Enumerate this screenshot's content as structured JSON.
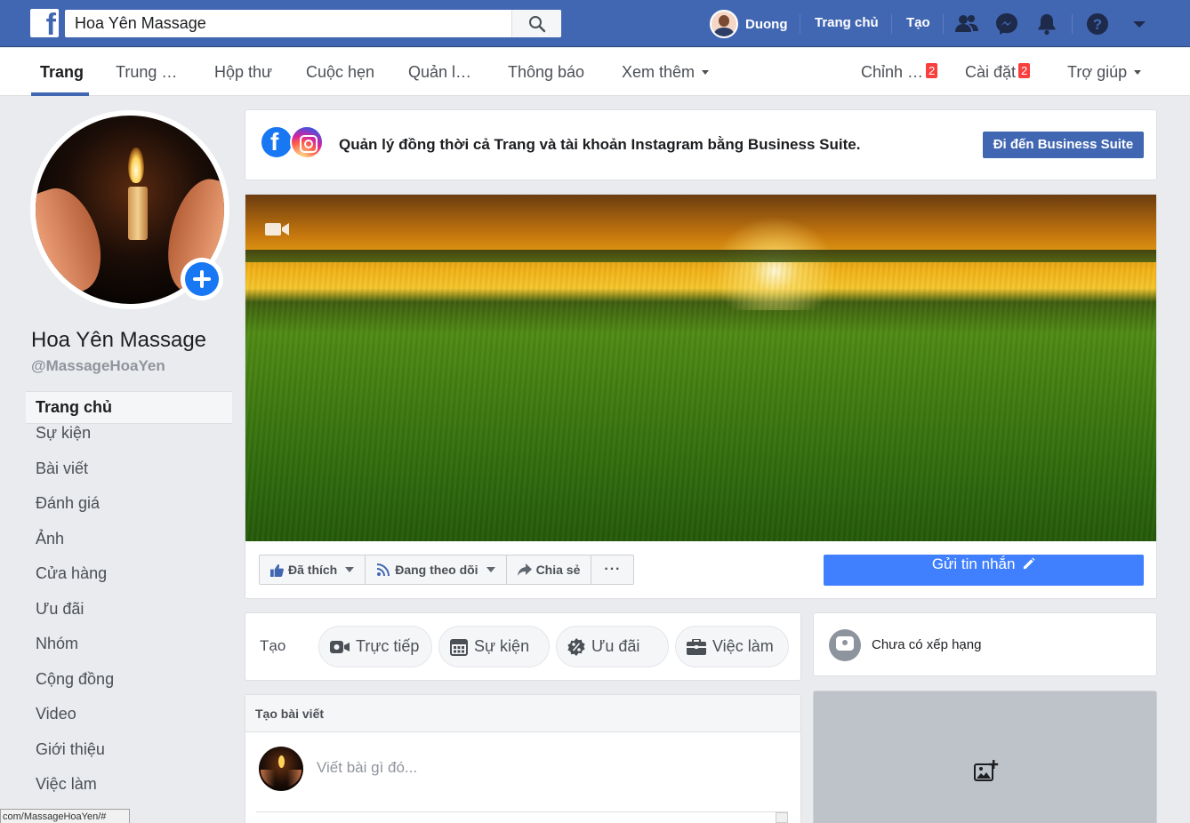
{
  "topbar": {
    "search_value": "Hoa Yên Massage",
    "user_name": "Duong",
    "home_label": "Trang chủ",
    "create_label": "Tạo",
    "logo_letter": "f"
  },
  "subnav": {
    "tabs": [
      "Trang",
      "Trung …",
      "Hộp thư",
      "Cuộc hẹn",
      "Quản l…",
      "Thông báo",
      "Xem thêm"
    ],
    "edit_label": "Chỉnh …",
    "edit_badge": "2",
    "settings_label": "Cài đặt",
    "settings_badge": "2",
    "help_label": "Trợ giúp"
  },
  "page": {
    "name": "Hoa Yên Massage",
    "handle": "@MassageHoaYen"
  },
  "sidebar": {
    "items": [
      "Trang chủ",
      "Sự kiện",
      "Bài viết",
      "Đánh giá",
      "Ảnh",
      "Cửa hàng",
      "Ưu đãi",
      "Nhóm",
      "Cộng đồng",
      "Video",
      "Giới thiệu",
      "Việc làm"
    ]
  },
  "status_url": "com/MassageHoaYen/#",
  "banner": {
    "text": "Quản lý đồng thời cả Trang và tài khoản Instagram bằng Business Suite.",
    "button": "Đi đến Business Suite"
  },
  "actions": {
    "liked": "Đã thích",
    "following": "Đang theo dõi",
    "share": "Chia sẻ",
    "more": "···",
    "message": "Gửi tin nhắn"
  },
  "create": {
    "label": "Tạo",
    "live": "Trực tiếp",
    "event": "Sự kiện",
    "offer": "Ưu đãi",
    "job": "Việc làm"
  },
  "rating": {
    "text": "Chưa có xếp hạng"
  },
  "post": {
    "header": "Tạo bài viết",
    "placeholder": "Viết bài gì đó..."
  },
  "colors": {
    "brand_blue": "#4267b2",
    "message_blue": "#4080ff",
    "badge_red": "#fa3e3e"
  }
}
